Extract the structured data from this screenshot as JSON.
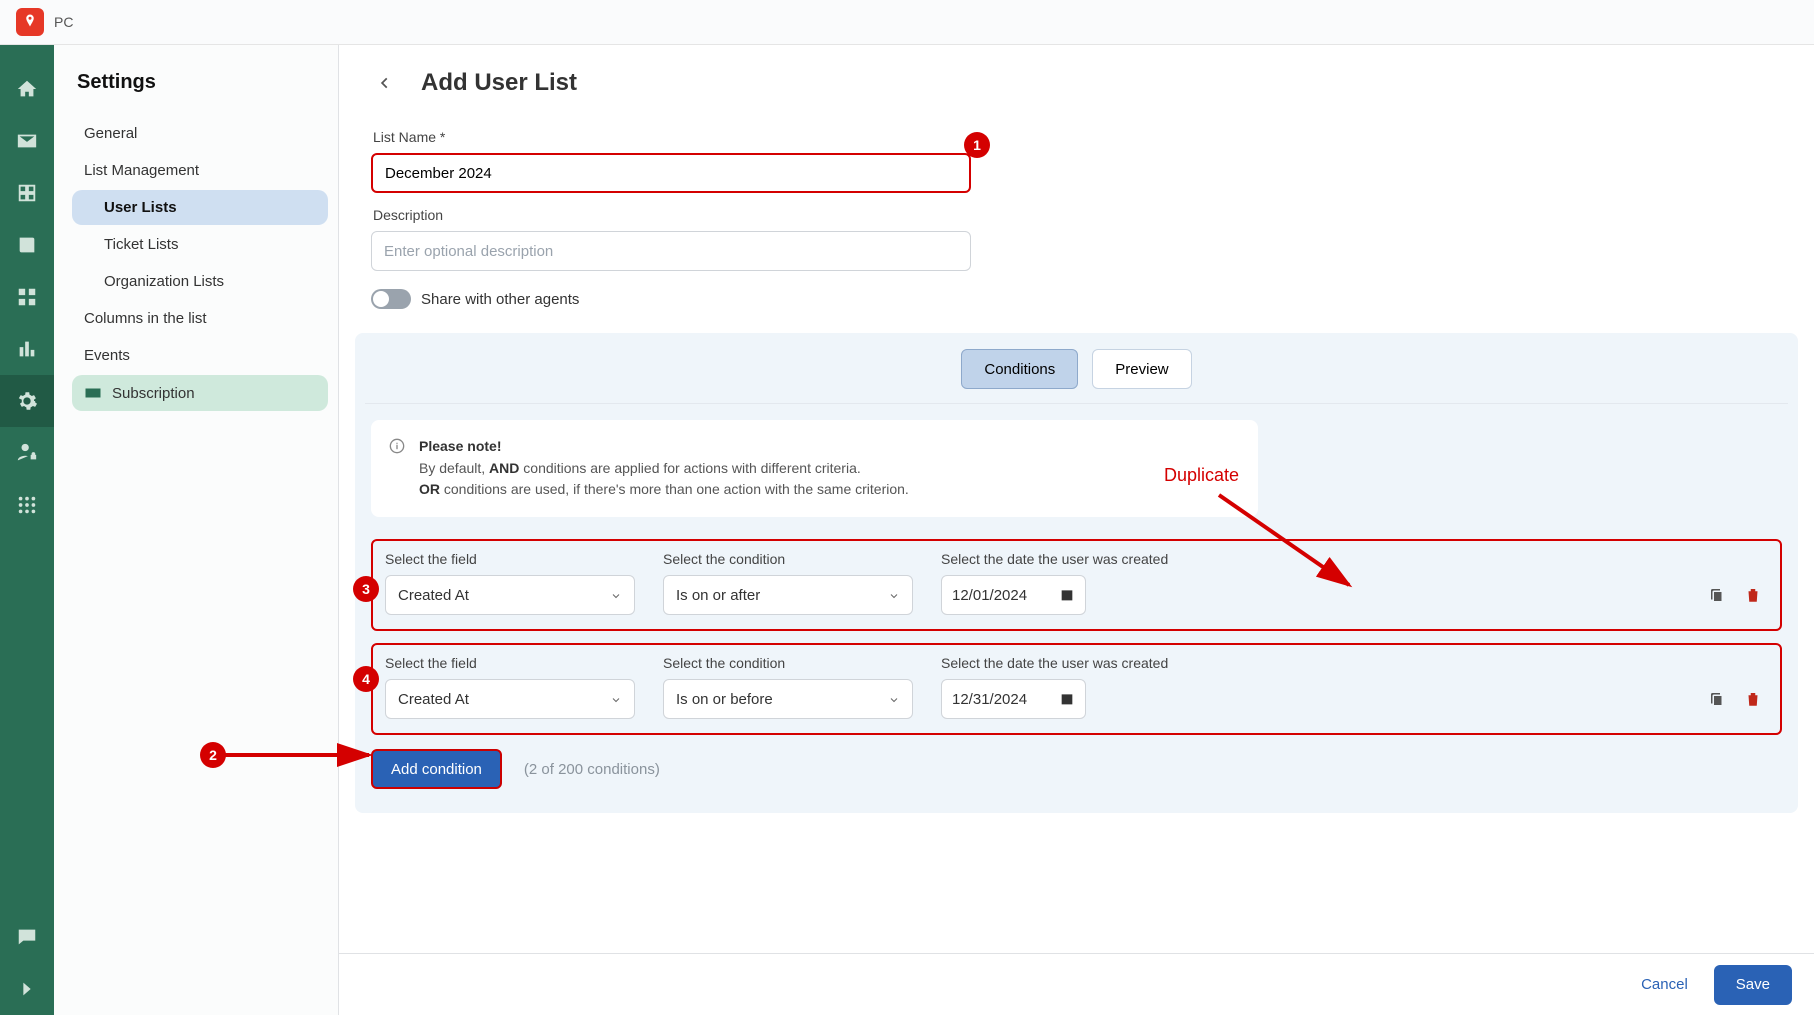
{
  "brand": "PC",
  "sidebar": {
    "title": "Settings",
    "items": [
      {
        "label": "General"
      },
      {
        "label": "List Management"
      },
      {
        "label": "User Lists"
      },
      {
        "label": "Ticket Lists"
      },
      {
        "label": "Organization Lists"
      },
      {
        "label": "Columns in the list"
      },
      {
        "label": "Events"
      },
      {
        "label": "Subscription"
      }
    ]
  },
  "page": {
    "title": "Add User List",
    "list_name_label": "List Name *",
    "list_name_value": "December 2024",
    "description_label": "Description",
    "description_placeholder": "Enter optional description",
    "share_label": "Share with other agents",
    "tabs": {
      "conditions": "Conditions",
      "preview": "Preview"
    },
    "note": {
      "heading": "Please note!",
      "line1_pre": "By default, ",
      "line1_bold": "AND",
      "line1_post": " conditions are applied for actions with different criteria.",
      "line2_bold": "OR",
      "line2_post": " conditions are used, if there's more than one action with the same criterion."
    },
    "col_labels": {
      "field": "Select the field",
      "condition": "Select the condition",
      "date": "Select the date the user was created"
    },
    "rows": [
      {
        "field": "Created At",
        "condition": "Is on or after",
        "date": "12/01/2024"
      },
      {
        "field": "Created At",
        "condition": "Is on or before",
        "date": "12/31/2024"
      }
    ],
    "add_condition": "Add condition",
    "count_text": "(2 of 200 conditions)"
  },
  "footer": {
    "cancel": "Cancel",
    "save": "Save"
  },
  "annotations": {
    "duplicate_label": "Duplicate",
    "badges": {
      "b1": "1",
      "b2": "2",
      "b3": "3",
      "b4": "4"
    }
  }
}
